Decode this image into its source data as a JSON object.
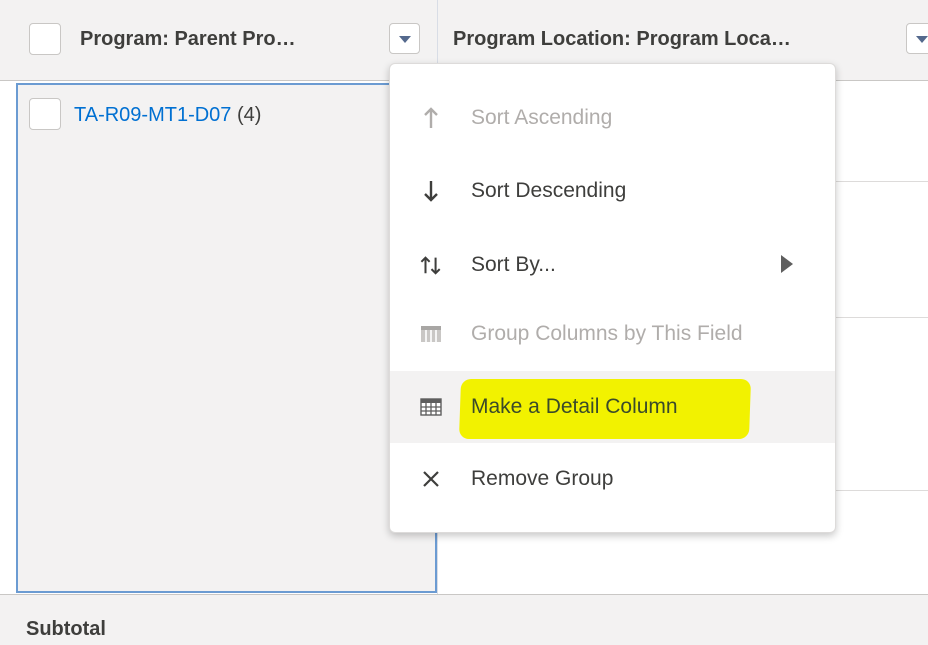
{
  "header": {
    "col1_title": "Program: Parent Pro…",
    "col2_title": "Program Location: Program Loca…"
  },
  "group": {
    "name": "TA-R09-MT1-D07",
    "count": "(4)"
  },
  "subtotal": {
    "label": "Subtotal"
  },
  "menu": {
    "items": [
      {
        "label": "Sort Ascending",
        "icon": "arrow-up-icon",
        "enabled": false
      },
      {
        "label": "Sort Descending",
        "icon": "arrow-down-icon",
        "enabled": true
      },
      {
        "label": "Sort By...",
        "icon": "sort-icon",
        "enabled": true
      },
      {
        "label": "Group Columns by This Field",
        "icon": "columns-icon",
        "enabled": false
      },
      {
        "label": "Make a Detail Column",
        "icon": "table-icon",
        "enabled": true,
        "highlighted": true
      },
      {
        "label": "Remove Group",
        "icon": "close-icon",
        "enabled": true
      }
    ]
  },
  "colors": {
    "link": "#0070d2",
    "highlight": "#f2f200",
    "header_bg": "#f3f2f2",
    "selection_border": "#6b9bd2"
  }
}
